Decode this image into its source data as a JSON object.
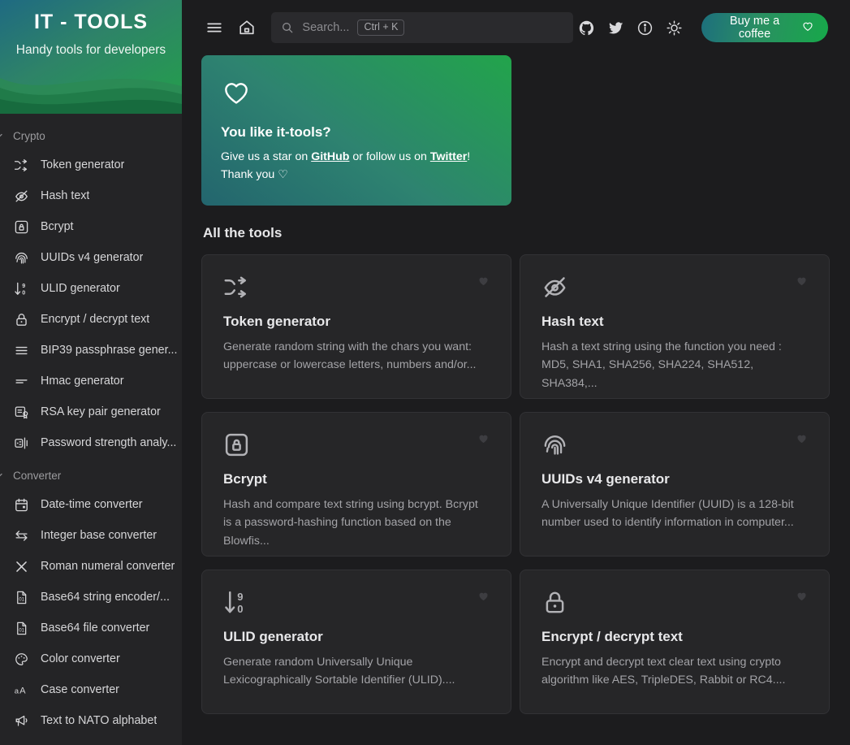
{
  "sidebar": {
    "title": "IT - TOOLS",
    "subtitle": "Handy tools for developers",
    "categories": [
      {
        "label": "Crypto",
        "items": [
          {
            "label": "Token generator",
            "icon": "shuffle-icon"
          },
          {
            "label": "Hash text",
            "icon": "eye-off-icon"
          },
          {
            "label": "Bcrypt",
            "icon": "lock-square-icon"
          },
          {
            "label": "UUIDs v4 generator",
            "icon": "fingerprint-icon"
          },
          {
            "label": "ULID generator",
            "icon": "sort-numeric-icon"
          },
          {
            "label": "Encrypt / decrypt text",
            "icon": "padlock-icon"
          },
          {
            "label": "BIP39 passphrase gener...",
            "icon": "list-icon"
          },
          {
            "label": "Hmac generator",
            "icon": "dashes-icon"
          },
          {
            "label": "RSA key pair generator",
            "icon": "certificate-icon"
          },
          {
            "label": "Password strength analy...",
            "icon": "password-meter-icon"
          }
        ]
      },
      {
        "label": "Converter",
        "items": [
          {
            "label": "Date-time converter",
            "icon": "calendar-icon"
          },
          {
            "label": "Integer base converter",
            "icon": "arrows-exchange-icon"
          },
          {
            "label": "Roman numeral converter",
            "icon": "roman-x-icon"
          },
          {
            "label": "Base64 string encoder/...",
            "icon": "file-binary-icon"
          },
          {
            "label": "Base64 file converter",
            "icon": "file-binary-icon"
          },
          {
            "label": "Color converter",
            "icon": "palette-icon"
          },
          {
            "label": "Case converter",
            "icon": "case-icon"
          },
          {
            "label": "Text to NATO alphabet",
            "icon": "megaphone-icon"
          }
        ]
      }
    ]
  },
  "topbar": {
    "menu_icon": "hamburger-menu-icon",
    "home_icon": "home-icon",
    "search": {
      "placeholder": "Search...",
      "value": "",
      "shortcut": "Ctrl + K",
      "icon": "search-icon"
    },
    "icons": [
      {
        "name": "github-icon"
      },
      {
        "name": "twitter-icon"
      },
      {
        "name": "info-icon"
      },
      {
        "name": "sun-icon"
      }
    ],
    "coffee_button": {
      "label": "Buy me a coffee",
      "icon": "heart-outline-icon"
    }
  },
  "banner": {
    "icon": "heart-outline-icon",
    "heading": "You like it-tools?",
    "line1_before": "Give us a star on ",
    "link_github": "GitHub",
    "line1_middle": " or follow us on ",
    "link_twitter": "Twitter",
    "line1_after": "!",
    "line2": "Thank you ♡"
  },
  "main": {
    "section_title": "All the tools",
    "cards": [
      {
        "title": "Token generator",
        "description": "Generate random string with the chars you want: uppercase or lowercase letters, numbers and/or...",
        "icon": "shuffle-icon",
        "favorite_icon": "heart-filled-icon"
      },
      {
        "title": "Hash text",
        "description": "Hash a text string using the function you need : MD5, SHA1, SHA256, SHA224, SHA512, SHA384,...",
        "icon": "eye-off-icon",
        "favorite_icon": "heart-filled-icon"
      },
      {
        "title": "Bcrypt",
        "description": "Hash and compare text string using bcrypt. Bcrypt is a password-hashing function based on the Blowfis...",
        "icon": "lock-square-icon",
        "favorite_icon": "heart-filled-icon"
      },
      {
        "title": "UUIDs v4 generator",
        "description": "A Universally Unique Identifier (UUID) is a 128-bit number used to identify information in computer...",
        "icon": "fingerprint-icon",
        "favorite_icon": "heart-filled-icon"
      },
      {
        "title": "ULID generator",
        "description": "Generate random Universally Unique Lexicographically Sortable Identifier (ULID)....",
        "icon": "sort-numeric-icon",
        "favorite_icon": "heart-filled-icon"
      },
      {
        "title": "Encrypt / decrypt text",
        "description": "Encrypt and decrypt text clear text using crypto algorithm like AES, TripleDES, Rabbit or RC4....",
        "icon": "padlock-icon",
        "favorite_icon": "heart-filled-icon"
      }
    ]
  },
  "colors": {
    "brand_green": "#18a058",
    "brand_teal": "#23656e",
    "sidebar_bg": "#242426",
    "main_bg": "#1c1c1e",
    "card_bg": "#262628"
  }
}
